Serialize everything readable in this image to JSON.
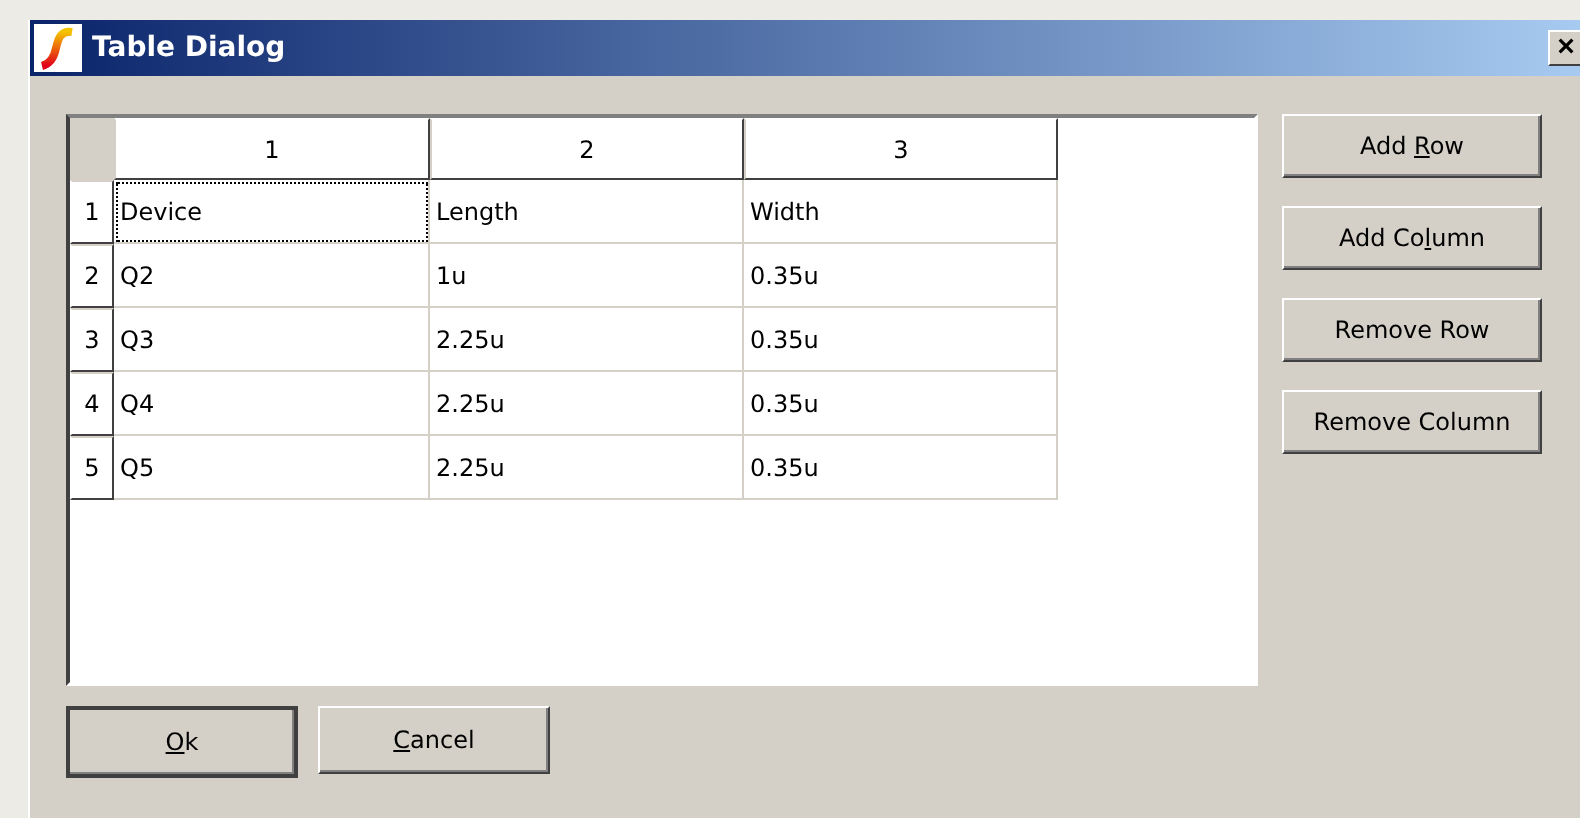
{
  "window": {
    "title": "Table Dialog",
    "close": "×"
  },
  "table": {
    "columns": [
      "1",
      "2",
      "3"
    ],
    "rows": [
      {
        "header": "1",
        "cells": [
          {
            "text": "Device",
            "focused": true
          },
          {
            "text": "Length",
            "focused": false
          },
          {
            "text": "Width",
            "focused": false
          }
        ]
      },
      {
        "header": "2",
        "cells": [
          {
            "text": "Q2",
            "focused": false
          },
          {
            "text": "1u",
            "focused": false
          },
          {
            "text": "0.35u",
            "focused": false
          }
        ]
      },
      {
        "header": "3",
        "cells": [
          {
            "text": "Q3",
            "focused": false
          },
          {
            "text": "2.25u",
            "focused": false
          },
          {
            "text": "0.35u",
            "focused": false
          }
        ]
      },
      {
        "header": "4",
        "cells": [
          {
            "text": "Q4",
            "focused": false
          },
          {
            "text": "2.25u",
            "focused": false
          },
          {
            "text": "0.35u",
            "focused": false
          }
        ]
      },
      {
        "header": "5",
        "cells": [
          {
            "text": "Q5",
            "focused": false
          },
          {
            "text": "2.25u",
            "focused": false
          },
          {
            "text": "0.35u",
            "focused": false
          }
        ]
      }
    ]
  },
  "side_buttons": [
    {
      "pre": "Add ",
      "key": "R",
      "post": "ow"
    },
    {
      "pre": "Add Co",
      "key": "l",
      "post": "umn"
    },
    {
      "pre": "Remove Row"
    },
    {
      "pre": "Remove Column"
    }
  ],
  "bottom_buttons": [
    {
      "key": "O",
      "post": "k",
      "default": true
    },
    {
      "key": "C",
      "post": "ancel",
      "default": false
    }
  ]
}
